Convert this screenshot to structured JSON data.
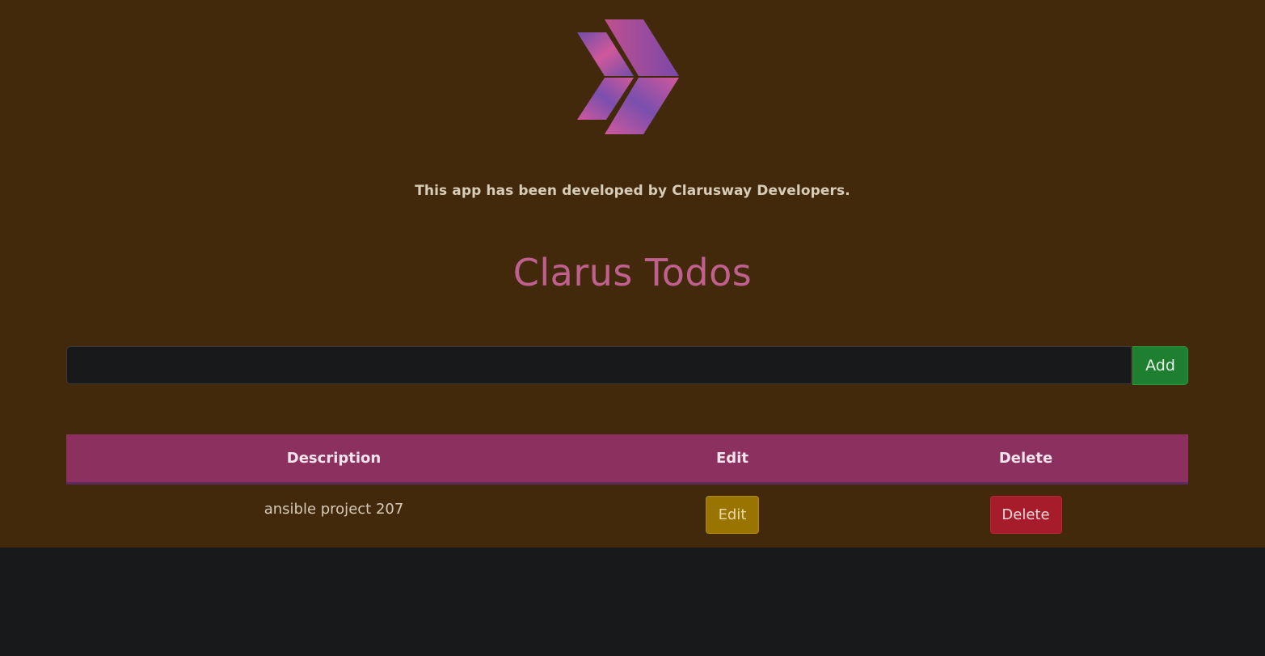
{
  "header": {
    "logo_icon": "clarusway-chevron-logo",
    "credit_text": "This app has been developed by Clarusway Developers."
  },
  "main": {
    "title": "Clarus Todos",
    "input": {
      "value": "",
      "placeholder": ""
    },
    "add_label": "Add"
  },
  "table": {
    "columns": [
      "Description",
      "Edit",
      "Delete"
    ],
    "rows": [
      {
        "description": "ansible project 207",
        "edit_label": "Edit",
        "delete_label": "Delete"
      }
    ]
  },
  "colors": {
    "page_background": "#43290b",
    "below_app_background": "#18191b",
    "title": "#c0608f",
    "table_header": "#8b305f",
    "add_button": "#1e7f31",
    "edit_button": "#9a7400",
    "delete_button": "#a61c2a"
  }
}
